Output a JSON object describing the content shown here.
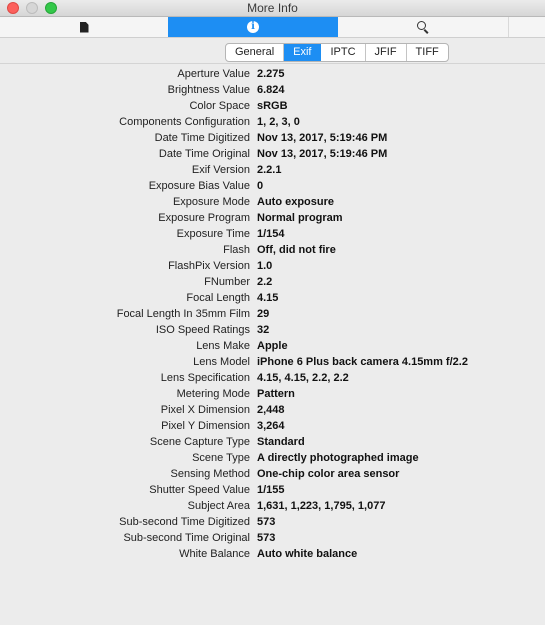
{
  "window": {
    "title": "More Info"
  },
  "toolbar": {
    "doc_icon": "document-icon",
    "info_icon": "info-icon",
    "search_icon": "search-icon",
    "active_color": "#1d8ef3"
  },
  "tabs": [
    {
      "label": "General",
      "active": false
    },
    {
      "label": "Exif",
      "active": true
    },
    {
      "label": "IPTC",
      "active": false
    },
    {
      "label": "JFIF",
      "active": false
    },
    {
      "label": "TIFF",
      "active": false
    }
  ],
  "properties": [
    {
      "key": "Aperture Value",
      "value": "2.275"
    },
    {
      "key": "Brightness Value",
      "value": "6.824"
    },
    {
      "key": "Color Space",
      "value": "sRGB"
    },
    {
      "key": "Components Configuration",
      "value": "1, 2, 3, 0"
    },
    {
      "key": "Date Time Digitized",
      "value": "Nov 13, 2017, 5:19:46 PM"
    },
    {
      "key": "Date Time Original",
      "value": "Nov 13, 2017, 5:19:46 PM"
    },
    {
      "key": "Exif Version",
      "value": "2.2.1"
    },
    {
      "key": "Exposure Bias Value",
      "value": "0"
    },
    {
      "key": "Exposure Mode",
      "value": "Auto exposure"
    },
    {
      "key": "Exposure Program",
      "value": "Normal program"
    },
    {
      "key": "Exposure Time",
      "value": "1/154"
    },
    {
      "key": "Flash",
      "value": "Off, did not fire"
    },
    {
      "key": "FlashPix Version",
      "value": "1.0"
    },
    {
      "key": "FNumber",
      "value": "2.2"
    },
    {
      "key": "Focal Length",
      "value": "4.15"
    },
    {
      "key": "Focal Length In 35mm Film",
      "value": "29"
    },
    {
      "key": "ISO Speed Ratings",
      "value": "32"
    },
    {
      "key": "Lens Make",
      "value": "Apple"
    },
    {
      "key": "Lens Model",
      "value": "iPhone 6 Plus back camera 4.15mm f/2.2"
    },
    {
      "key": "Lens Specification",
      "value": "4.15, 4.15, 2.2, 2.2"
    },
    {
      "key": "Metering Mode",
      "value": "Pattern"
    },
    {
      "key": "Pixel X Dimension",
      "value": "2,448"
    },
    {
      "key": "Pixel Y Dimension",
      "value": "3,264"
    },
    {
      "key": "Scene Capture Type",
      "value": "Standard"
    },
    {
      "key": "Scene Type",
      "value": "A directly photographed image"
    },
    {
      "key": "Sensing Method",
      "value": "One-chip color area sensor"
    },
    {
      "key": "Shutter Speed Value",
      "value": "1/155"
    },
    {
      "key": "Subject Area",
      "value": "1,631, 1,223, 1,795, 1,077"
    },
    {
      "key": "Sub-second Time Digitized",
      "value": "573"
    },
    {
      "key": "Sub-second Time Original",
      "value": "573"
    },
    {
      "key": "White Balance",
      "value": "Auto white balance"
    }
  ]
}
